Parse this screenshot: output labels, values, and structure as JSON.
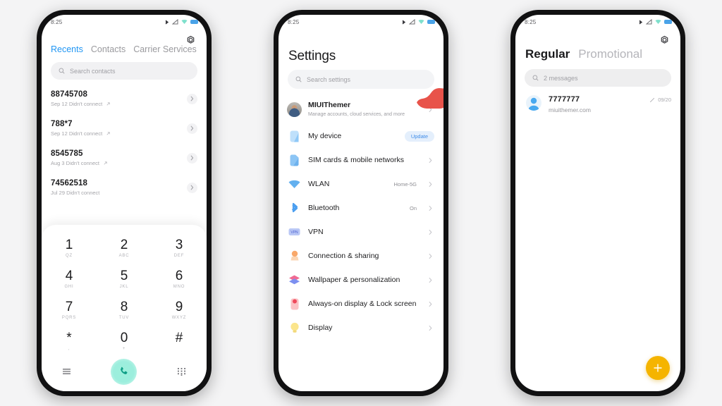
{
  "status_bar": {
    "time": "8:25",
    "icons": [
      "bluetooth-icon",
      "signal-icon",
      "wifi-icon",
      "battery-icon"
    ]
  },
  "colors": {
    "accent_blue": "#2196f3",
    "call_green": "#9ceedd",
    "fab_amber": "#f5b400",
    "blob_red": "#e8534a",
    "pill_blue": "#3f8ce8"
  },
  "dialer": {
    "gear_icon": "gear-icon",
    "tabs": [
      {
        "label": "Recents",
        "active": true
      },
      {
        "label": "Contacts",
        "active": false
      },
      {
        "label": "Carrier Services",
        "active": false
      }
    ],
    "search": {
      "placeholder": "Search contacts",
      "icon": "search-icon"
    },
    "calls": [
      {
        "number": "88745708",
        "detail": "Sep 12 Didn't connect"
      },
      {
        "number": "788*7",
        "detail": "Sep 12 Didn't connect"
      },
      {
        "number": "8545785",
        "detail": "Aug 3 Didn't connect"
      },
      {
        "number": "74562518",
        "detail": "Jul 29 Didn't connect"
      }
    ],
    "keypad": [
      {
        "digit": "1",
        "letters": "QZ"
      },
      {
        "digit": "2",
        "letters": "ABC"
      },
      {
        "digit": "3",
        "letters": "DEF"
      },
      {
        "digit": "4",
        "letters": "GHI"
      },
      {
        "digit": "5",
        "letters": "JKL"
      },
      {
        "digit": "6",
        "letters": "MNO"
      },
      {
        "digit": "7",
        "letters": "PQRS"
      },
      {
        "digit": "8",
        "letters": "TUV"
      },
      {
        "digit": "9",
        "letters": "WXYZ"
      },
      {
        "digit": "*",
        "letters": ","
      },
      {
        "digit": "0",
        "letters": "+"
      },
      {
        "digit": "#",
        "letters": ""
      }
    ],
    "bottom_bar": {
      "menu_icon": "hamburger-menu-icon",
      "call_icon": "phone-call-icon",
      "keypad_icon": "keypad-grid-icon"
    }
  },
  "settings": {
    "title": "Settings",
    "search": {
      "placeholder": "Search settings",
      "icon": "search-icon"
    },
    "items": [
      {
        "label": "MIUIThemer",
        "sub": "Manage accounts, cloud services, and more",
        "icon": "user-avatar",
        "value": "",
        "badge": "",
        "chevron": true
      },
      {
        "label": "My device",
        "sub": "",
        "icon": "device-icon",
        "value": "",
        "badge": "Update",
        "chevron": false
      },
      {
        "label": "SIM cards & mobile networks",
        "sub": "",
        "icon": "sim-card-icon",
        "value": "",
        "badge": "",
        "chevron": true
      },
      {
        "label": "WLAN",
        "sub": "",
        "icon": "wifi-icon",
        "value": "Home-5G",
        "badge": "",
        "chevron": true
      },
      {
        "label": "Bluetooth",
        "sub": "",
        "icon": "bluetooth-icon",
        "value": "On",
        "badge": "",
        "chevron": true
      },
      {
        "label": "VPN",
        "sub": "",
        "icon": "vpn-icon",
        "value": "",
        "badge": "",
        "chevron": true
      },
      {
        "label": "Connection & sharing",
        "sub": "",
        "icon": "connection-sharing-icon",
        "value": "",
        "badge": "",
        "chevron": true
      },
      {
        "label": "Wallpaper & personalization",
        "sub": "",
        "icon": "wallpaper-icon",
        "value": "",
        "badge": "",
        "chevron": true
      },
      {
        "label": "Always-on display & Lock screen",
        "sub": "",
        "icon": "lock-screen-icon",
        "value": "",
        "badge": "",
        "chevron": true
      },
      {
        "label": "Display",
        "sub": "",
        "icon": "display-bulb-icon",
        "value": "",
        "badge": "",
        "chevron": true
      }
    ]
  },
  "messages": {
    "gear_icon": "gear-icon",
    "tabs": [
      {
        "label": "Regular",
        "active": true
      },
      {
        "label": "Promotional",
        "active": false
      }
    ],
    "search": {
      "placeholder": "2 messages",
      "icon": "search-icon"
    },
    "threads": [
      {
        "name": "7777777",
        "snippet": "miuithemer.com",
        "date": "09/20",
        "draft_icon": "pencil-draft-icon",
        "avatar": "contact-avatar"
      }
    ],
    "fab": {
      "icon": "plus-icon",
      "label": "+"
    }
  }
}
